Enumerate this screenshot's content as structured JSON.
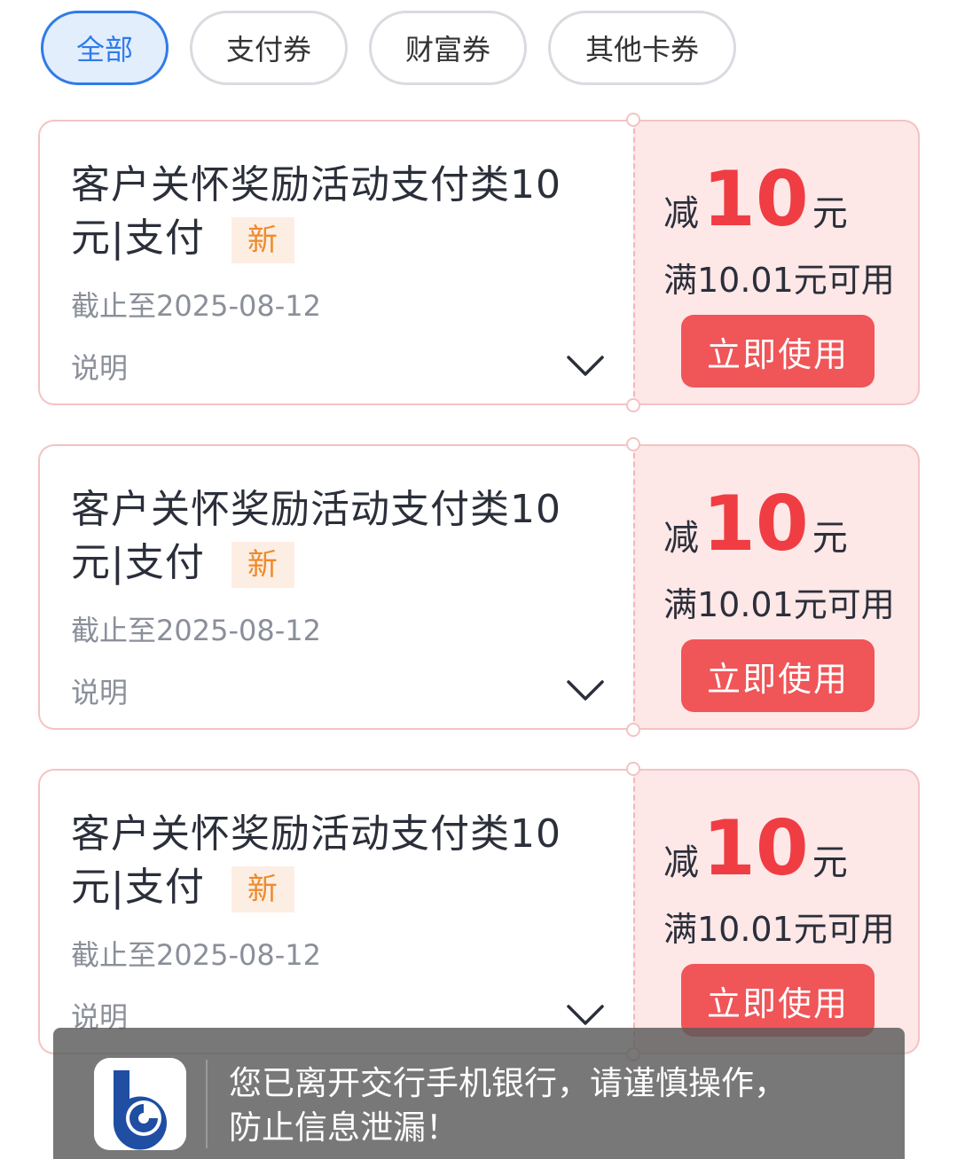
{
  "tabs": [
    {
      "label": "全部",
      "active": true
    },
    {
      "label": "支付券",
      "active": false
    },
    {
      "label": "财富券",
      "active": false
    },
    {
      "label": "其他卡券",
      "active": false
    }
  ],
  "coupons": [
    {
      "title": "客户关怀奖励活动支付类10元|支付",
      "badge": "新",
      "deadline": "截止至2025-08-12",
      "desc_label": "说明",
      "amount_prefix": "减",
      "amount": "10",
      "amount_unit": "元",
      "condition": "满10.01元可用",
      "button": "立即使用"
    },
    {
      "title": "客户关怀奖励活动支付类10元|支付",
      "badge": "新",
      "deadline": "截止至2025-08-12",
      "desc_label": "说明",
      "amount_prefix": "减",
      "amount": "10",
      "amount_unit": "元",
      "condition": "满10.01元可用",
      "button": "立即使用"
    },
    {
      "title": "客户关怀奖励活动支付类10元|支付",
      "badge": "新",
      "deadline": "截止至2025-08-12",
      "desc_label": "说明",
      "amount_prefix": "减",
      "amount": "10",
      "amount_unit": "元",
      "condition": "满10.01元可用",
      "button": "立即使用"
    }
  ],
  "toast": {
    "icon": "bank-logo-icon",
    "message_line1": "您已离开交行手机银行，请谨慎操作，",
    "message_line2": "防止信息泄漏！"
  },
  "colors": {
    "accent": "#2f7bea",
    "price": "#ef3d43",
    "button": "#f05558",
    "badge_text": "#ee8a2b",
    "coupon_bg": "#fde7e7"
  }
}
